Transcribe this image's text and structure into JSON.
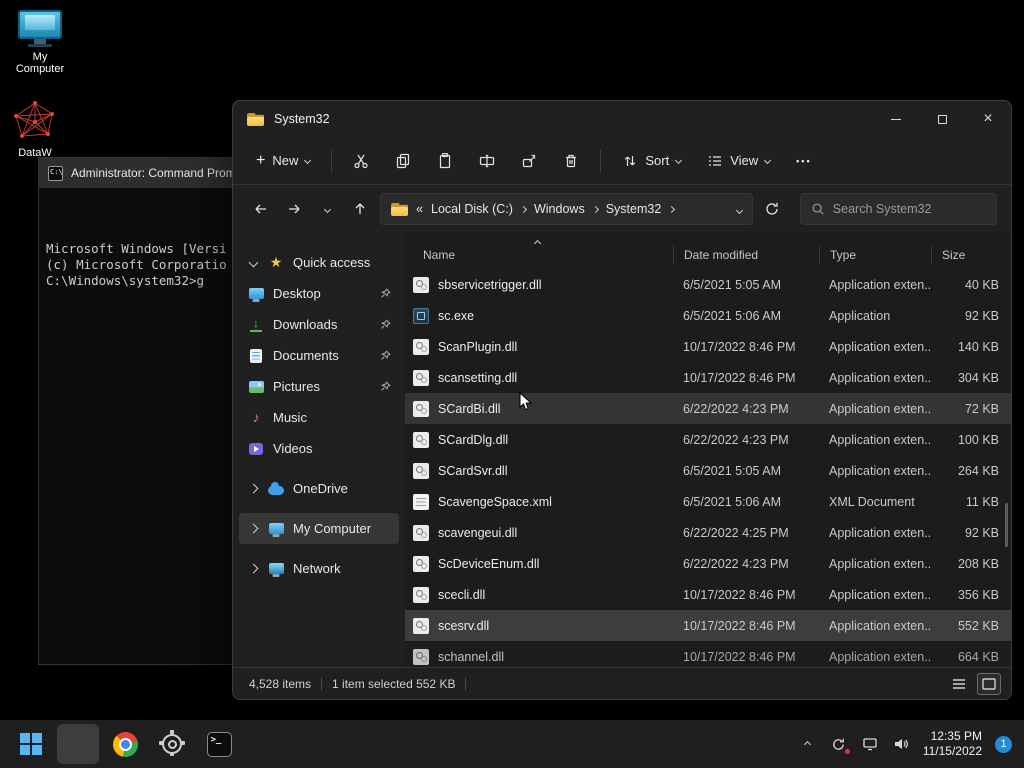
{
  "colors": {
    "accent_blue": "#58b6f2",
    "selection_gray": "#3d3d3d",
    "folder_yellow": "#f7b93e",
    "badge_blue": "#1e8fd5",
    "dataw_red": "#c0392b"
  },
  "desktop": {
    "icons": [
      {
        "label": "My Computer"
      },
      {
        "label": "DataW"
      }
    ]
  },
  "cmd": {
    "title": "Administrator: Command Prom",
    "lines": [
      "Microsoft Windows [Versi",
      "(c) Microsoft Corporatio",
      "C:\\Windows\\system32>g"
    ]
  },
  "explorer": {
    "title": "System32",
    "toolbar": {
      "new_label": "New",
      "sort_label": "Sort",
      "view_label": "View"
    },
    "breadcrumb_prefix": "«",
    "breadcrumb": [
      {
        "label": "Local Disk (C:)"
      },
      {
        "label": "Windows"
      },
      {
        "label": "System32"
      }
    ],
    "search_placeholder": "Search System32",
    "sidebar": [
      {
        "name": "sidebar-item-quick-access",
        "label": "Quick access",
        "icon": "str",
        "chevron": "d",
        "pinned": false,
        "state": ""
      },
      {
        "name": "sidebar-item-desktop",
        "label": "Desktop",
        "icon": "mon",
        "chevron": "",
        "pinned": true,
        "state": ""
      },
      {
        "name": "sidebar-item-downloads",
        "label": "Downloads",
        "icon": "dl",
        "chevron": "",
        "pinned": true,
        "state": ""
      },
      {
        "name": "sidebar-item-documents",
        "label": "Documents",
        "icon": "doc",
        "chevron": "",
        "pinned": true,
        "state": ""
      },
      {
        "name": "sidebar-item-pictures",
        "label": "Pictures",
        "icon": "pic",
        "chevron": "",
        "pinned": true,
        "state": ""
      },
      {
        "name": "sidebar-item-music",
        "label": "Music",
        "icon": "mus",
        "chevron": "",
        "pinned": false,
        "state": ""
      },
      {
        "name": "sidebar-item-videos",
        "label": "Videos",
        "icon": "vid",
        "chevron": "",
        "pinned": false,
        "state": ""
      },
      {
        "name": "sidebar-item-onedrive",
        "label": "OneDrive",
        "icon": "cld",
        "chevron": "r",
        "pinned": false,
        "state": "gap"
      },
      {
        "name": "sidebar-item-my-computer",
        "label": "My Computer",
        "icon": "mon",
        "chevron": "r",
        "pinned": false,
        "state": "gap selected"
      },
      {
        "name": "sidebar-item-network",
        "label": "Network",
        "icon": "mon net",
        "chevron": "r",
        "pinned": false,
        "state": "gap"
      }
    ],
    "columns": [
      "Name",
      "Date modified",
      "Type",
      "Size"
    ],
    "files": [
      {
        "name": "sbservicetrigger.dll",
        "date": "6/5/2021 5:05 AM",
        "type": "Application exten...",
        "size": "40 KB",
        "icon": "dll",
        "state": ""
      },
      {
        "name": "sc.exe",
        "date": "6/5/2021 5:06 AM",
        "type": "Application",
        "size": "92 KB",
        "icon": "exe",
        "state": ""
      },
      {
        "name": "ScanPlugin.dll",
        "date": "10/17/2022 8:46 PM",
        "type": "Application exten...",
        "size": "140 KB",
        "icon": "dll",
        "state": ""
      },
      {
        "name": "scansetting.dll",
        "date": "10/17/2022 8:46 PM",
        "type": "Application exten...",
        "size": "304 KB",
        "icon": "dll",
        "state": ""
      },
      {
        "name": "SCardBi.dll",
        "date": "6/22/2022 4:23 PM",
        "type": "Application exten...",
        "size": "72 KB",
        "icon": "dll",
        "state": "hover"
      },
      {
        "name": "SCardDlg.dll",
        "date": "6/22/2022 4:23 PM",
        "type": "Application exten...",
        "size": "100 KB",
        "icon": "dll",
        "state": ""
      },
      {
        "name": "SCardSvr.dll",
        "date": "6/5/2021 5:05 AM",
        "type": "Application exten...",
        "size": "264 KB",
        "icon": "dll",
        "state": ""
      },
      {
        "name": "ScavengeSpace.xml",
        "date": "6/5/2021 5:06 AM",
        "type": "XML Document",
        "size": "11 KB",
        "icon": "xml",
        "state": ""
      },
      {
        "name": "scavengeui.dll",
        "date": "6/22/2022 4:25 PM",
        "type": "Application exten...",
        "size": "92 KB",
        "icon": "dll",
        "state": ""
      },
      {
        "name": "ScDeviceEnum.dll",
        "date": "6/22/2022 4:23 PM",
        "type": "Application exten...",
        "size": "208 KB",
        "icon": "dll",
        "state": ""
      },
      {
        "name": "scecli.dll",
        "date": "10/17/2022 8:46 PM",
        "type": "Application exten...",
        "size": "356 KB",
        "icon": "dll",
        "state": ""
      },
      {
        "name": "scesrv.dll",
        "date": "10/17/2022 8:46 PM",
        "type": "Application exten...",
        "size": "552 KB",
        "icon": "dll",
        "state": "selected"
      },
      {
        "name": "schannel.dll",
        "date": "10/17/2022 8:46 PM",
        "type": "Application exten...",
        "size": "664 KB",
        "icon": "dll",
        "state": "partial"
      }
    ],
    "status": {
      "items_count": "4,528 items",
      "selection": "1 item selected 552 KB"
    }
  },
  "taskbar": {
    "items": [
      {
        "name": "taskbar-start-button",
        "icon": "windows",
        "state": ""
      },
      {
        "name": "taskbar-explorer-button",
        "icon": "explorer",
        "state": "active"
      },
      {
        "name": "taskbar-chrome-button",
        "icon": "chrome",
        "state": ""
      },
      {
        "name": "taskbar-settings-button",
        "icon": "gear",
        "state": ""
      },
      {
        "name": "taskbar-terminal-button",
        "icon": "terminal",
        "state": ""
      }
    ],
    "tray": {
      "time": "12:35 PM",
      "date": "11/15/2022",
      "badge": "1"
    }
  }
}
